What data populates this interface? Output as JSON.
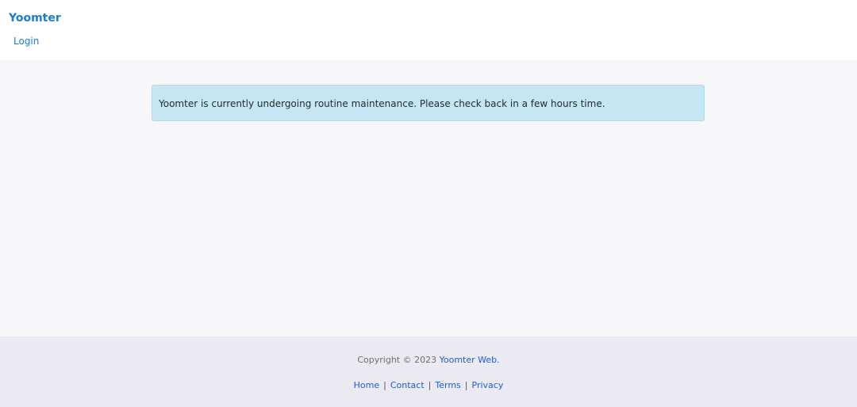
{
  "header": {
    "brand": "Yoomter",
    "login_label": "Login"
  },
  "main": {
    "alert_text": "Yoomter is currently undergoing routine maintenance. Please check back in a few hours time."
  },
  "footer": {
    "copyright_prefix": "Copyright © 2023",
    "copyright_link": "Yoomter Web.",
    "separator": "|",
    "links": [
      "Home",
      "Contact",
      "Terms",
      "Privacy"
    ]
  },
  "colors": {
    "brand": "#1a7fd0",
    "alert_bg": "#c5e6f2",
    "page_bg": "#f7f6f9",
    "footer_bg": "#ebeaf3"
  }
}
